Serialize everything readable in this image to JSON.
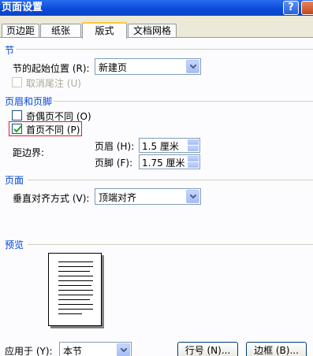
{
  "window": {
    "title": "页面设置"
  },
  "tabs": [
    {
      "label": "页边距"
    },
    {
      "label": "纸张"
    },
    {
      "label": "版式"
    },
    {
      "label": "文档网格"
    }
  ],
  "section_start": {
    "heading": "节",
    "start_label": "节的起始位置 (R):",
    "start_value": "新建页",
    "suppress_endnotes_label": "取消尾注 (U)"
  },
  "headers_footers": {
    "heading": "页眉和页脚",
    "odd_even_label": "奇偶页不同 (O)",
    "odd_even_checked": false,
    "first_page_label": "首页不同 (P)",
    "first_page_checked": true,
    "from_edge_label": "距边界:",
    "header_label": "页眉 (H):",
    "header_value": "1.5 厘米",
    "footer_label": "页脚 (F):",
    "footer_value": "1.75 厘米"
  },
  "page": {
    "heading": "页面",
    "vertical_align_label": "垂直对齐方式 (V):",
    "vertical_align_value": "顶端对齐"
  },
  "preview": {
    "heading": "预览"
  },
  "bottom": {
    "apply_to_label": "应用于 (Y):",
    "apply_to_value": "本节",
    "line_numbers_button": "行号 (N)...",
    "borders_button": "边框 (B)..."
  },
  "colors": {
    "section_heading": "#0046d5",
    "titlebar": "#0a4bd8",
    "highlight": "#e02020"
  }
}
